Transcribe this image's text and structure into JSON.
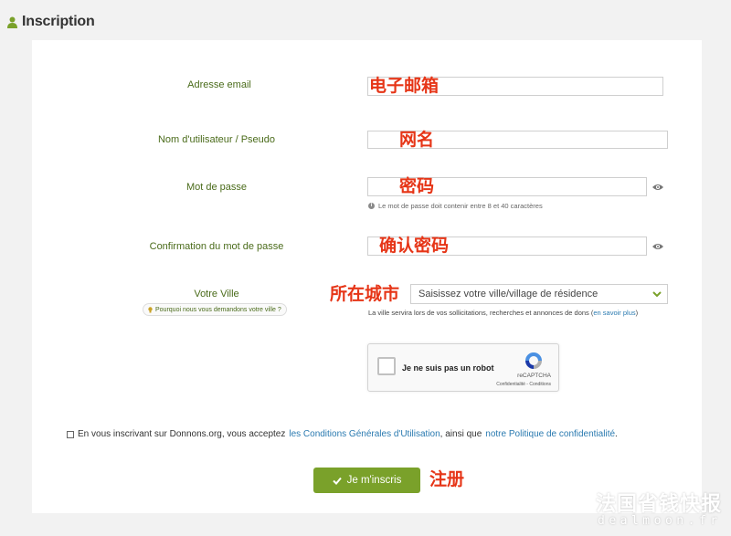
{
  "header": {
    "title": "Inscription",
    "icon": "user-icon"
  },
  "form": {
    "email": {
      "label": "Adresse email",
      "value": "",
      "annotation": "电子邮箱"
    },
    "username": {
      "label": "Nom d'utilisateur / Pseudo",
      "value": "",
      "annotation": "网名"
    },
    "password": {
      "label": "Mot de passe",
      "value": "",
      "annotation": "密码",
      "hint": "Le mot de passe doit contenir entre 8 et 40 caractères"
    },
    "password_confirm": {
      "label": "Confirmation du mot de passe",
      "value": "",
      "annotation": "确认密码"
    },
    "city": {
      "label": "Votre Ville",
      "annotation": "所在城市",
      "why_link": "Pourquoi nous vous demandons votre ville ?",
      "select_value": "Saisissez votre ville/village de résidence",
      "info_text": "La ville servira lors de vos sollicitations, recherches et annonces de dons (",
      "info_link": "en savoir plus",
      "info_end": ")"
    },
    "captcha": {
      "label": "Je ne suis pas un robot",
      "brand": "reCAPTCHA",
      "terms": "Confidentialité - Conditions"
    },
    "terms": {
      "text1": "En vous inscrivant sur Donnons.org, vous acceptez",
      "link1": "les Conditions Générales d'Utilisation",
      "text2": ", ainsi que",
      "link2": "notre Politique de confidentialité",
      "text3": "."
    },
    "submit": {
      "label": "Je m'inscris",
      "annotation": "注册"
    }
  },
  "watermark": {
    "line1": "法国省钱快报",
    "line2": "dealmoon.fr"
  },
  "colors": {
    "accent": "#7aa12a",
    "label": "#4a6b1a",
    "annotation": "#e63517",
    "link": "#2a7ab0"
  }
}
